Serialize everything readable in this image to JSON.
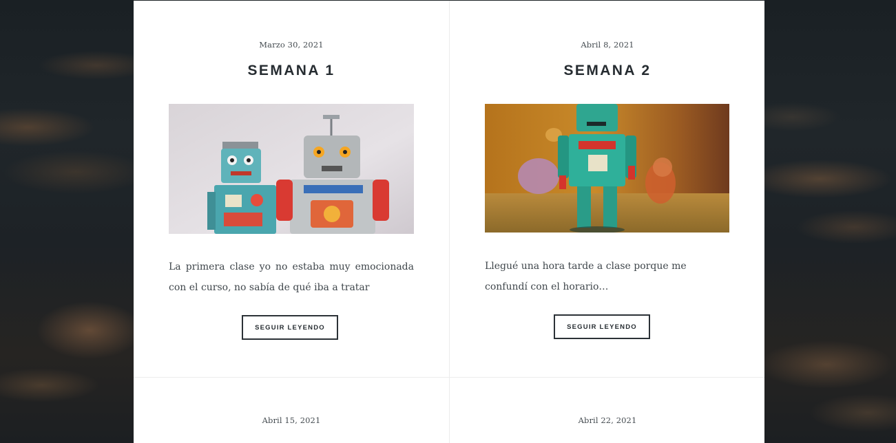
{
  "posts": [
    {
      "date": "Marzo 30, 2021",
      "title": "SEMANA 1",
      "image": "robot-toys-photo",
      "excerpt": "La primera clase yo no estaba muy emocionada con el curso, no sabía de qué iba a tratar",
      "read_more_label": "SEGUIR LEYENDO"
    },
    {
      "date": "Abril 8, 2021",
      "title": "SEMANA 2",
      "image": "green-robot-toy-photo",
      "excerpt": "Llegué una hora tarde a clase porque me confundí con el horario…",
      "read_more_label": "SEGUIR LEYENDO"
    },
    {
      "date": "Abril 15, 2021"
    },
    {
      "date": "Abril 22, 2021"
    }
  ],
  "colors": {
    "panel_background": "#ffffff",
    "page_background": "#1d2226",
    "title_text": "#262c31",
    "body_text": "#3f464b",
    "button_border": "#2b3136"
  }
}
